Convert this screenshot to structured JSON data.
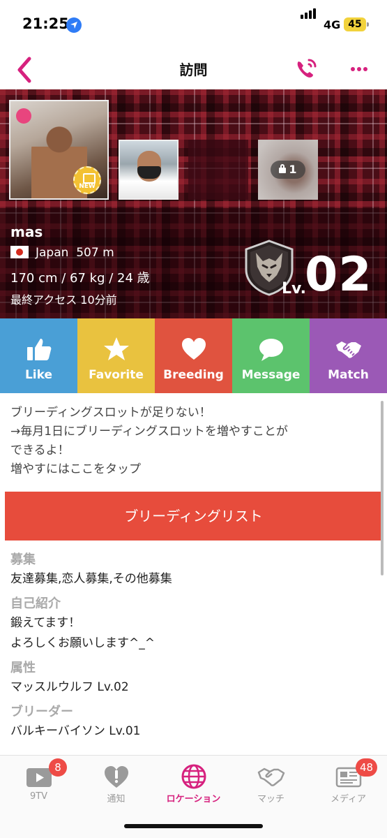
{
  "status_bar": {
    "time": "21:25",
    "network": "4G",
    "battery": "45"
  },
  "header": {
    "title": "訪問",
    "icons": [
      "back-icon",
      "call-icon",
      "more-icon"
    ]
  },
  "profile": {
    "photo_locked_count": "1",
    "new_badge": "NEW",
    "name": "mas",
    "country": "Japan",
    "distance": "507 m",
    "stats": "170 cm / 67 kg / 24 歳",
    "last_access": "最終アクセス 10分前",
    "level_prefix": "Lv.",
    "level": "02"
  },
  "actions": [
    {
      "label": "Like",
      "icon": "thumbs-up-icon",
      "color": "#4a9fd6"
    },
    {
      "label": "Favorite",
      "icon": "star-icon",
      "color": "#e9c23f"
    },
    {
      "label": "Breeding",
      "icon": "heart-icon",
      "color": "#e0533f"
    },
    {
      "label": "Message",
      "icon": "chat-bubble-icon",
      "color": "#5cc36d"
    },
    {
      "label": "Match",
      "icon": "handshake-icon",
      "color": "#9b59b6"
    }
  ],
  "notice": {
    "line1": "ブリーディングスロットが足りない！",
    "line2": "→毎月1日にブリーディングスロットを増やすことが",
    "line3": "できるよ！",
    "line4": "増やすにはここをタップ"
  },
  "breeding_button": "ブリーディングリスト",
  "sections": {
    "recruit": {
      "heading": "募集",
      "value": "友達募集,恋人募集,その他募集"
    },
    "intro": {
      "heading": "自己紹介",
      "line1": "鍛えてます！",
      "line2": "よろしくお願いします^_^"
    },
    "attribute": {
      "heading": "属性",
      "value": "マッスルウルフ Lv.02"
    },
    "breeder": {
      "heading": "ブリーダー",
      "value": "バルキーバイソン Lv.01"
    }
  },
  "tabs": [
    {
      "label": "9TV",
      "icon": "tv-play-icon",
      "badge": "8"
    },
    {
      "label": "通知",
      "icon": "heart-alert-icon"
    },
    {
      "label": "ロケーション",
      "icon": "globe-icon",
      "active": true
    },
    {
      "label": "マッチ",
      "icon": "handshake-icon"
    },
    {
      "label": "メディア",
      "icon": "newspaper-icon",
      "badge": "48"
    }
  ],
  "colors": {
    "accent": "#d6217e",
    "breeding_button": "#e74c3c",
    "badge": "#ee4b46"
  }
}
